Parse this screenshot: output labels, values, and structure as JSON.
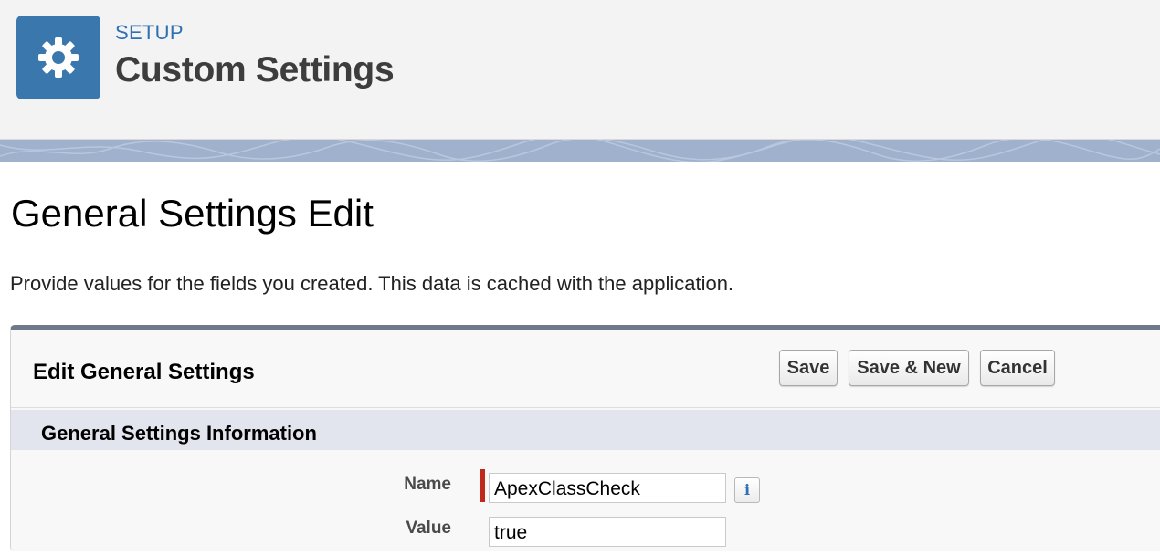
{
  "header": {
    "eyebrow": "SETUP",
    "title": "Custom Settings",
    "icon": "gear-icon",
    "icon_bg": "#3a77ad"
  },
  "page": {
    "title": "General Settings Edit",
    "description": "Provide values for the fields you created. This data is cached with the application."
  },
  "panel": {
    "title": "Edit General Settings",
    "buttons": {
      "save": "Save",
      "save_new": "Save & New",
      "cancel": "Cancel"
    },
    "section": {
      "title": "General Settings Information"
    },
    "fields": {
      "name": {
        "label": "Name",
        "value": "ApexClassCheck",
        "required": true,
        "help_icon": "info-icon"
      },
      "value": {
        "label": "Value",
        "value": "true"
      }
    }
  },
  "colors": {
    "required": "#c0281c",
    "link_blue": "#2f6fb3",
    "banner": "#9fb1cd",
    "panel_border": "#6e7a8a"
  }
}
